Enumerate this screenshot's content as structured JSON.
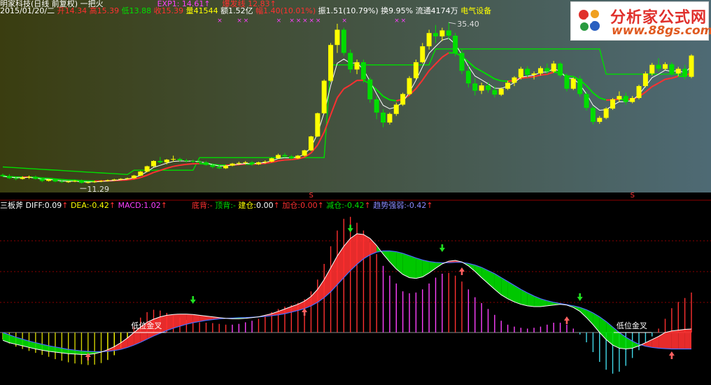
{
  "header": {
    "title": "明家科技(日线 前复权) 一把火",
    "exp_label": "EXP1:",
    "exp_value": "14.61",
    "break_label": "爆发线",
    "break_value": "12.83",
    "date": "2015/01/20/二",
    "open_label": "开",
    "open_value": "14.34",
    "high_label": "高",
    "high_value": "15.39",
    "low_label": "低",
    "low_value": "13.88",
    "close_label": "收",
    "close_value": "15.39",
    "vol_label": "量",
    "vol_value": "41544",
    "amt_label": "额",
    "amt_value": "1.52亿",
    "chg_label": "幅",
    "chg_value": "1.40(10.01%)",
    "amp_label": "振",
    "amp_value": "1.51(10.79%)",
    "turn_label": "换",
    "turn_value": "9.95%",
    "float_label": "流通",
    "float_value": "4174万",
    "sector": "电气设备",
    "arrow_up": "↑",
    "x_mark": "×"
  },
  "indicator": {
    "name": "三板斧",
    "diff_label": "DIFF:",
    "diff_value": "0.09",
    "dea_label": "DEA:",
    "dea_value": "-0.42",
    "macd_label": "MACD:",
    "macd_value": "1.02",
    "bottom_div_label": "底背:",
    "bottom_div_value": "-",
    "top_div_label": "顶背:",
    "top_div_value": "-",
    "build_label": "建仓:",
    "build_value": "0.00",
    "add_label": "加仓:",
    "add_value": "0.00",
    "reduce_label": "减仓:",
    "reduce_value": "-0.42",
    "trend_label": "趋势强弱:",
    "trend_value": "-0.42"
  },
  "logo": {
    "title": "分析家公式网",
    "url": "www.88gs.com"
  },
  "colors": {
    "up": "#ffff00",
    "down": "#00dd00",
    "red": "#ff3030",
    "magenta": "#ff40ff",
    "cyan": "#40d8e8",
    "grid": "#8b0000",
    "blue": "#4a6cff",
    "bg_left": "#3a3d10",
    "bg_right": "#4e6a74"
  },
  "chart_data": [
    {
      "type": "candlestick",
      "annotations": [
        {
          "text": "35.40",
          "kind": "price-high"
        },
        {
          "text": "11.29",
          "kind": "price-low"
        },
        {
          "text": "S",
          "kind": "signal-marker"
        },
        {
          "text": "S",
          "kind": "signal-marker"
        }
      ],
      "candles": [
        [
          12.6,
          12.8,
          12.3,
          12.4
        ],
        [
          12.4,
          12.7,
          12.0,
          12.1
        ],
        [
          12.1,
          12.3,
          11.8,
          12.0
        ],
        [
          12.0,
          12.4,
          11.9,
          12.2
        ],
        [
          12.2,
          12.5,
          12.0,
          12.3
        ],
        [
          12.3,
          12.5,
          11.9,
          12.0
        ],
        [
          12.0,
          12.1,
          11.5,
          11.7
        ],
        [
          11.7,
          12.0,
          11.6,
          11.9
        ],
        [
          11.9,
          12.0,
          11.5,
          11.6
        ],
        [
          11.6,
          11.8,
          11.4,
          11.5
        ],
        [
          11.5,
          11.7,
          11.4,
          11.6
        ],
        [
          11.6,
          11.8,
          11.5,
          11.7
        ],
        [
          11.7,
          11.9,
          11.3,
          11.4
        ],
        [
          11.4,
          11.6,
          11.3,
          11.5
        ],
        [
          11.5,
          11.7,
          11.4,
          11.6
        ],
        [
          11.6,
          11.8,
          11.5,
          11.7
        ],
        [
          11.7,
          11.9,
          11.6,
          11.8
        ],
        [
          11.8,
          12.0,
          11.7,
          11.9
        ],
        [
          11.9,
          12.1,
          11.8,
          12.0
        ],
        [
          12.0,
          12.2,
          11.9,
          12.1
        ],
        [
          12.1,
          12.6,
          12.0,
          12.5
        ],
        [
          12.5,
          13.2,
          12.4,
          13.1
        ],
        [
          13.1,
          14.0,
          13.0,
          13.9
        ],
        [
          13.9,
          14.8,
          13.8,
          14.7
        ],
        [
          14.7,
          15.3,
          14.3,
          14.5
        ],
        [
          14.5,
          15.0,
          14.2,
          14.9
        ],
        [
          14.9,
          15.5,
          14.6,
          15.0
        ],
        [
          15.0,
          15.2,
          14.6,
          14.8
        ],
        [
          14.8,
          15.0,
          14.5,
          14.7
        ],
        [
          14.7,
          14.9,
          14.4,
          14.6
        ],
        [
          14.6,
          14.8,
          14.3,
          14.5
        ],
        [
          14.5,
          14.7,
          14.0,
          14.1
        ],
        [
          14.1,
          14.3,
          13.6,
          13.8
        ],
        [
          13.8,
          14.0,
          13.5,
          13.6
        ],
        [
          13.6,
          14.1,
          13.5,
          14.0
        ],
        [
          14.0,
          14.4,
          13.9,
          14.3
        ],
        [
          14.3,
          14.6,
          14.1,
          14.4
        ],
        [
          14.4,
          14.7,
          14.2,
          14.5
        ],
        [
          14.5,
          14.7,
          14.0,
          14.2
        ],
        [
          14.2,
          14.6,
          14.1,
          14.5
        ],
        [
          14.5,
          14.8,
          14.3,
          14.6
        ],
        [
          14.6,
          15.2,
          14.5,
          15.1
        ],
        [
          15.1,
          15.8,
          15.0,
          15.6
        ],
        [
          15.6,
          15.9,
          15.2,
          15.4
        ],
        [
          15.4,
          15.6,
          14.9,
          15.1
        ],
        [
          15.1,
          15.6,
          15.0,
          15.5
        ],
        [
          15.5,
          16.4,
          15.4,
          16.3
        ],
        [
          16.3,
          18.5,
          16.2,
          18.4
        ],
        [
          18.4,
          22.0,
          18.3,
          21.9
        ],
        [
          21.9,
          27.0,
          21.8,
          26.8
        ],
        [
          26.8,
          32.5,
          26.6,
          32.2
        ],
        [
          32.2,
          35.4,
          31.0,
          34.5
        ],
        [
          34.5,
          34.8,
          30.6,
          31.0
        ],
        [
          31.0,
          31.5,
          28.0,
          28.5
        ],
        [
          28.5,
          30.0,
          27.8,
          29.6
        ],
        [
          29.6,
          30.0,
          26.5,
          27.0
        ],
        [
          27.0,
          27.3,
          23.5,
          24.0
        ],
        [
          24.0,
          24.5,
          21.0,
          22.0
        ],
        [
          22.0,
          22.5,
          19.8,
          20.5
        ],
        [
          20.5,
          22.0,
          20.2,
          21.8
        ],
        [
          21.8,
          23.5,
          21.5,
          23.2
        ],
        [
          23.2,
          25.0,
          23.0,
          24.8
        ],
        [
          24.8,
          27.5,
          24.6,
          27.2
        ],
        [
          27.2,
          30.0,
          27.0,
          29.6
        ],
        [
          29.6,
          32.5,
          29.4,
          32.0
        ],
        [
          32.0,
          34.5,
          31.5,
          34.0
        ],
        [
          34.0,
          35.2,
          32.5,
          33.5
        ],
        [
          33.5,
          34.8,
          32.8,
          34.4
        ],
        [
          34.4,
          35.6,
          33.0,
          33.6
        ],
        [
          33.6,
          34.0,
          30.5,
          31.0
        ],
        [
          31.0,
          31.5,
          27.8,
          28.3
        ],
        [
          28.3,
          29.0,
          25.8,
          26.4
        ],
        [
          26.4,
          27.2,
          24.6,
          25.3
        ],
        [
          25.3,
          26.5,
          24.8,
          26.1
        ],
        [
          26.1,
          26.6,
          25.0,
          25.4
        ],
        [
          25.4,
          26.0,
          24.3,
          24.7
        ],
        [
          24.7,
          25.8,
          24.5,
          25.6
        ],
        [
          25.6,
          26.8,
          25.4,
          26.5
        ],
        [
          26.5,
          27.5,
          26.0,
          27.3
        ],
        [
          27.3,
          28.9,
          27.0,
          28.6
        ],
        [
          28.6,
          29.0,
          27.3,
          27.7
        ],
        [
          27.7,
          28.2,
          27.0,
          27.9
        ],
        [
          27.9,
          29.0,
          27.6,
          28.7
        ],
        [
          28.7,
          29.4,
          27.8,
          28.2
        ],
        [
          28.2,
          29.8,
          28.0,
          29.4
        ],
        [
          29.4,
          29.6,
          27.3,
          27.6
        ],
        [
          27.6,
          27.9,
          25.2,
          25.6
        ],
        [
          25.6,
          27.3,
          25.4,
          27.1
        ],
        [
          27.1,
          27.5,
          24.4,
          24.8
        ],
        [
          24.8,
          25.2,
          22.3,
          22.7
        ],
        [
          22.7,
          23.0,
          20.2,
          20.6
        ],
        [
          20.6,
          21.5,
          20.3,
          21.2
        ],
        [
          21.2,
          22.8,
          21.0,
          22.6
        ],
        [
          22.6,
          24.2,
          22.4,
          24.0
        ],
        [
          24.0,
          25.2,
          23.6,
          24.5
        ],
        [
          24.5,
          25.0,
          23.2,
          23.6
        ],
        [
          23.6,
          24.5,
          23.4,
          24.2
        ],
        [
          24.2,
          26.2,
          24.0,
          26.0
        ],
        [
          26.0,
          28.2,
          25.8,
          27.9
        ],
        [
          27.9,
          29.5,
          27.6,
          29.2
        ],
        [
          29.2,
          30.2,
          28.2,
          28.6
        ],
        [
          28.6,
          29.6,
          28.4,
          29.3
        ],
        [
          29.3,
          29.6,
          27.6,
          27.9
        ],
        [
          27.9,
          28.9,
          27.5,
          28.6
        ],
        [
          28.6,
          29.2,
          27.0,
          27.4
        ],
        [
          27.4,
          30.8,
          27.2,
          30.6
        ]
      ]
    },
    {
      "type": "macd",
      "macd": [
        -0.18,
        -0.28,
        -0.36,
        -0.42,
        -0.47,
        -0.52,
        -0.57,
        -0.62,
        -0.68,
        -0.72,
        -0.76,
        -0.79,
        -0.81,
        -0.83,
        -0.82,
        -0.78,
        -0.7,
        -0.58,
        -0.4,
        -0.15,
        0.15,
        0.38,
        0.52,
        0.58,
        0.56,
        0.5,
        0.44,
        0.38,
        0.32,
        0.28,
        0.26,
        0.25,
        0.24,
        0.22,
        0.2,
        0.2,
        0.22,
        0.26,
        0.3,
        0.35,
        0.42,
        0.52,
        0.6,
        0.66,
        0.7,
        0.75,
        0.85,
        1.05,
        1.35,
        1.75,
        2.2,
        2.6,
        2.9,
        2.95,
        2.8,
        2.6,
        2.3,
        2.0,
        1.7,
        1.45,
        1.25,
        1.05,
        1.0,
        1.02,
        1.1,
        1.25,
        1.4,
        1.5,
        1.52,
        1.45,
        1.3,
        1.1,
        0.9,
        0.75,
        0.6,
        0.45,
        0.3,
        0.2,
        0.15,
        0.12,
        0.1,
        0.12,
        0.15,
        0.2,
        0.25,
        0.25,
        0.2,
        0.1,
        -0.05,
        -0.25,
        -0.5,
        -0.75,
        -0.95,
        -1.05,
        -1.0,
        -0.85,
        -0.65,
        -0.45,
        -0.25,
        -0.1,
        0.1,
        0.35,
        0.62,
        0.78,
        0.88,
        1.02
      ],
      "diff": [
        -0.2,
        -0.26,
        -0.3,
        -0.34,
        -0.38,
        -0.42,
        -0.45,
        -0.48,
        -0.5,
        -0.52,
        -0.54,
        -0.55,
        -0.56,
        -0.56,
        -0.54,
        -0.5,
        -0.44,
        -0.36,
        -0.26,
        -0.14,
        0.0,
        0.14,
        0.26,
        0.34,
        0.4,
        0.44,
        0.46,
        0.47,
        0.47,
        0.46,
        0.44,
        0.42,
        0.4,
        0.38,
        0.36,
        0.35,
        0.35,
        0.36,
        0.38,
        0.4,
        0.44,
        0.48,
        0.54,
        0.6,
        0.66,
        0.72,
        0.8,
        0.92,
        1.1,
        1.35,
        1.65,
        1.95,
        2.2,
        2.4,
        2.52,
        2.5,
        2.4,
        2.22,
        2.0,
        1.8,
        1.62,
        1.48,
        1.4,
        1.38,
        1.42,
        1.52,
        1.64,
        1.75,
        1.82,
        1.84,
        1.8,
        1.7,
        1.56,
        1.4,
        1.25,
        1.1,
        0.96,
        0.86,
        0.78,
        0.72,
        0.68,
        0.66,
        0.66,
        0.68,
        0.7,
        0.72,
        0.7,
        0.64,
        0.54,
        0.38,
        0.2,
        0.0,
        -0.18,
        -0.32,
        -0.4,
        -0.42,
        -0.4,
        -0.34,
        -0.26,
        -0.18,
        -0.1,
        0.0,
        0.04,
        0.06,
        0.08,
        0.09
      ],
      "dea": [
        0.0,
        -0.06,
        -0.12,
        -0.17,
        -0.22,
        -0.26,
        -0.3,
        -0.34,
        -0.37,
        -0.4,
        -0.43,
        -0.45,
        -0.47,
        -0.48,
        -0.49,
        -0.49,
        -0.48,
        -0.46,
        -0.43,
        -0.38,
        -0.32,
        -0.25,
        -0.17,
        -0.09,
        -0.02,
        0.05,
        0.11,
        0.16,
        0.21,
        0.25,
        0.28,
        0.31,
        0.33,
        0.35,
        0.36,
        0.37,
        0.38,
        0.38,
        0.39,
        0.4,
        0.41,
        0.43,
        0.45,
        0.48,
        0.52,
        0.56,
        0.61,
        0.68,
        0.77,
        0.89,
        1.04,
        1.22,
        1.4,
        1.58,
        1.74,
        1.88,
        1.98,
        2.05,
        2.08,
        2.08,
        2.06,
        2.02,
        1.96,
        1.9,
        1.85,
        1.81,
        1.79,
        1.78,
        1.78,
        1.79,
        1.79,
        1.76,
        1.72,
        1.66,
        1.58,
        1.5,
        1.4,
        1.3,
        1.2,
        1.1,
        1.01,
        0.93,
        0.86,
        0.81,
        0.77,
        0.74,
        0.71,
        0.68,
        0.64,
        0.58,
        0.5,
        0.4,
        0.28,
        0.14,
        0.0,
        -0.12,
        -0.22,
        -0.3,
        -0.35,
        -0.38,
        -0.4,
        -0.41,
        -0.42,
        -0.42,
        -0.42,
        -0.42
      ],
      "signals": [
        {
          "text": "低位金叉",
          "kind": "golden-cross-low"
        },
        {
          "text": "低位金叉",
          "kind": "golden-cross-low"
        }
      ]
    }
  ]
}
